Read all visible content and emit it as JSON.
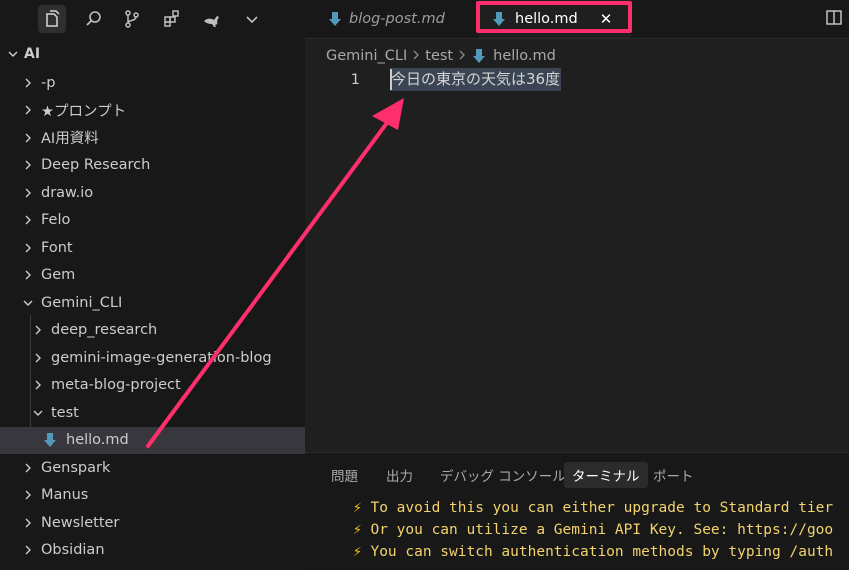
{
  "sidebar": {
    "activity_icons": [
      "files-icon",
      "search-icon",
      "source-control-icon",
      "extensions-icon",
      "kangaroo-icon",
      "chevron-down-icon"
    ],
    "root_label": "AI",
    "items": [
      {
        "label": "-p",
        "type": "folder",
        "expanded": false,
        "depth": 0
      },
      {
        "label": "★プロンプト",
        "type": "folder",
        "expanded": false,
        "depth": 0
      },
      {
        "label": "AI用資料",
        "type": "folder",
        "expanded": false,
        "depth": 0
      },
      {
        "label": "Deep Research",
        "type": "folder",
        "expanded": false,
        "depth": 0
      },
      {
        "label": "draw.io",
        "type": "folder",
        "expanded": false,
        "depth": 0
      },
      {
        "label": "Felo",
        "type": "folder",
        "expanded": false,
        "depth": 0
      },
      {
        "label": "Font",
        "type": "folder",
        "expanded": false,
        "depth": 0
      },
      {
        "label": "Gem",
        "type": "folder",
        "expanded": false,
        "depth": 0
      },
      {
        "label": "Gemini_CLI",
        "type": "folder",
        "expanded": true,
        "depth": 0
      },
      {
        "label": "deep_research",
        "type": "folder",
        "expanded": false,
        "depth": 1
      },
      {
        "label": "gemini-image-generation-blog",
        "type": "folder",
        "expanded": false,
        "depth": 1
      },
      {
        "label": "meta-blog-project",
        "type": "folder",
        "expanded": false,
        "depth": 1
      },
      {
        "label": "test",
        "type": "folder",
        "expanded": true,
        "depth": 1
      },
      {
        "label": "hello.md",
        "type": "file",
        "selected": true,
        "depth": 2
      },
      {
        "label": "Genspark",
        "type": "folder",
        "expanded": false,
        "depth": 0
      },
      {
        "label": "Manus",
        "type": "folder",
        "expanded": false,
        "depth": 0
      },
      {
        "label": "Newsletter",
        "type": "folder",
        "expanded": false,
        "depth": 0
      },
      {
        "label": "Obsidian",
        "type": "folder",
        "expanded": false,
        "depth": 0
      }
    ]
  },
  "tabs": [
    {
      "label": "blog-post.md",
      "active": false,
      "preview": true
    },
    {
      "label": "hello.md",
      "active": true,
      "close": "✕"
    }
  ],
  "breadcrumb": [
    "Gemini_CLI",
    "test",
    "hello.md"
  ],
  "editor": {
    "line_number": "1",
    "line_text": "今日の東京の天気は36度"
  },
  "panel": {
    "tabs": [
      "問題",
      "出力",
      "デバッグ コンソール",
      "ターミナル",
      "ポート"
    ],
    "active_tab": "ターミナル",
    "terminal_lines": [
      "To avoid this you can either upgrade to Standard tier",
      "Or you can utilize a Gemini API Key. See: https://goo",
      "You can switch authentication methods by typing /auth"
    ]
  },
  "colors": {
    "accent": "#ff2e6d",
    "markdown_icon": "#519aba",
    "terminal_text": "#f2d36c"
  }
}
